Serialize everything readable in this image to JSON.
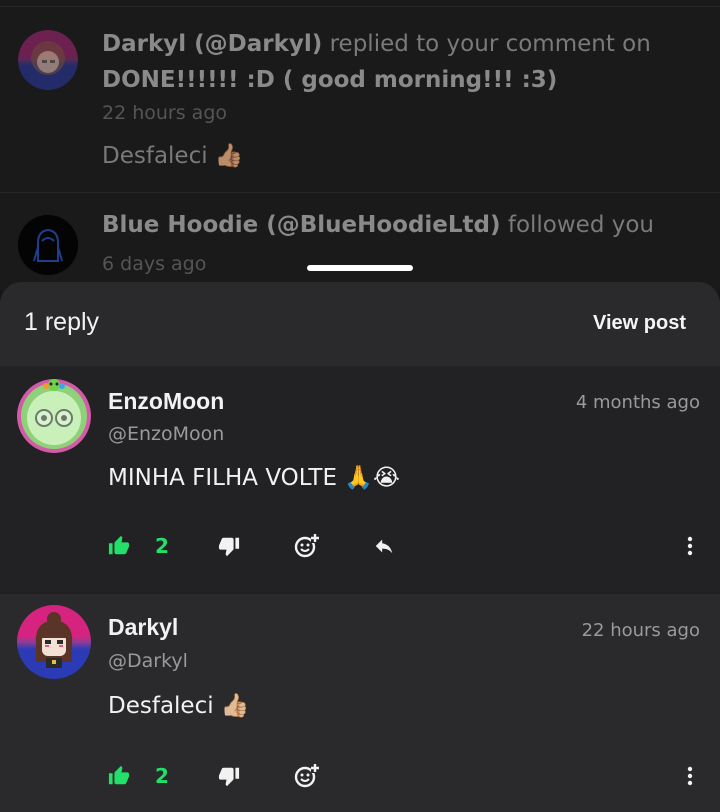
{
  "notifications": [
    {
      "user_display": "Darkyl (@Darkyl)",
      "action": "replied to your comment on",
      "post_title": "DONE!!!!!! :D ( good morning!!! :3)",
      "time": "22 hours ago",
      "comment": "Desfaleci 👍🏽"
    },
    {
      "user_display": "Blue Hoodie (@BlueHoodieLtd)",
      "action": "followed you",
      "time": "6 days ago"
    }
  ],
  "sheet": {
    "title": "1 reply",
    "view_post_label": "View post"
  },
  "comments": [
    {
      "name": "EnzoMoon",
      "handle": "@EnzoMoon",
      "time": "4 months ago",
      "text": "MINHA FILHA VOLTE 🙏😭",
      "likes": "2"
    },
    {
      "name": "Darkyl",
      "handle": "@Darkyl",
      "time": "22 hours ago",
      "text": "Desfaleci 👍🏼",
      "likes": "2"
    }
  ],
  "icons": {
    "like": "thumbs-up-icon",
    "dislike": "thumbs-down-icon",
    "react": "add-reaction-icon",
    "reply": "reply-icon",
    "more": "more-vertical-icon"
  },
  "colors": {
    "like_active": "#22e06a",
    "sheet_bg": "#212121",
    "header_bg": "#2a292b"
  }
}
